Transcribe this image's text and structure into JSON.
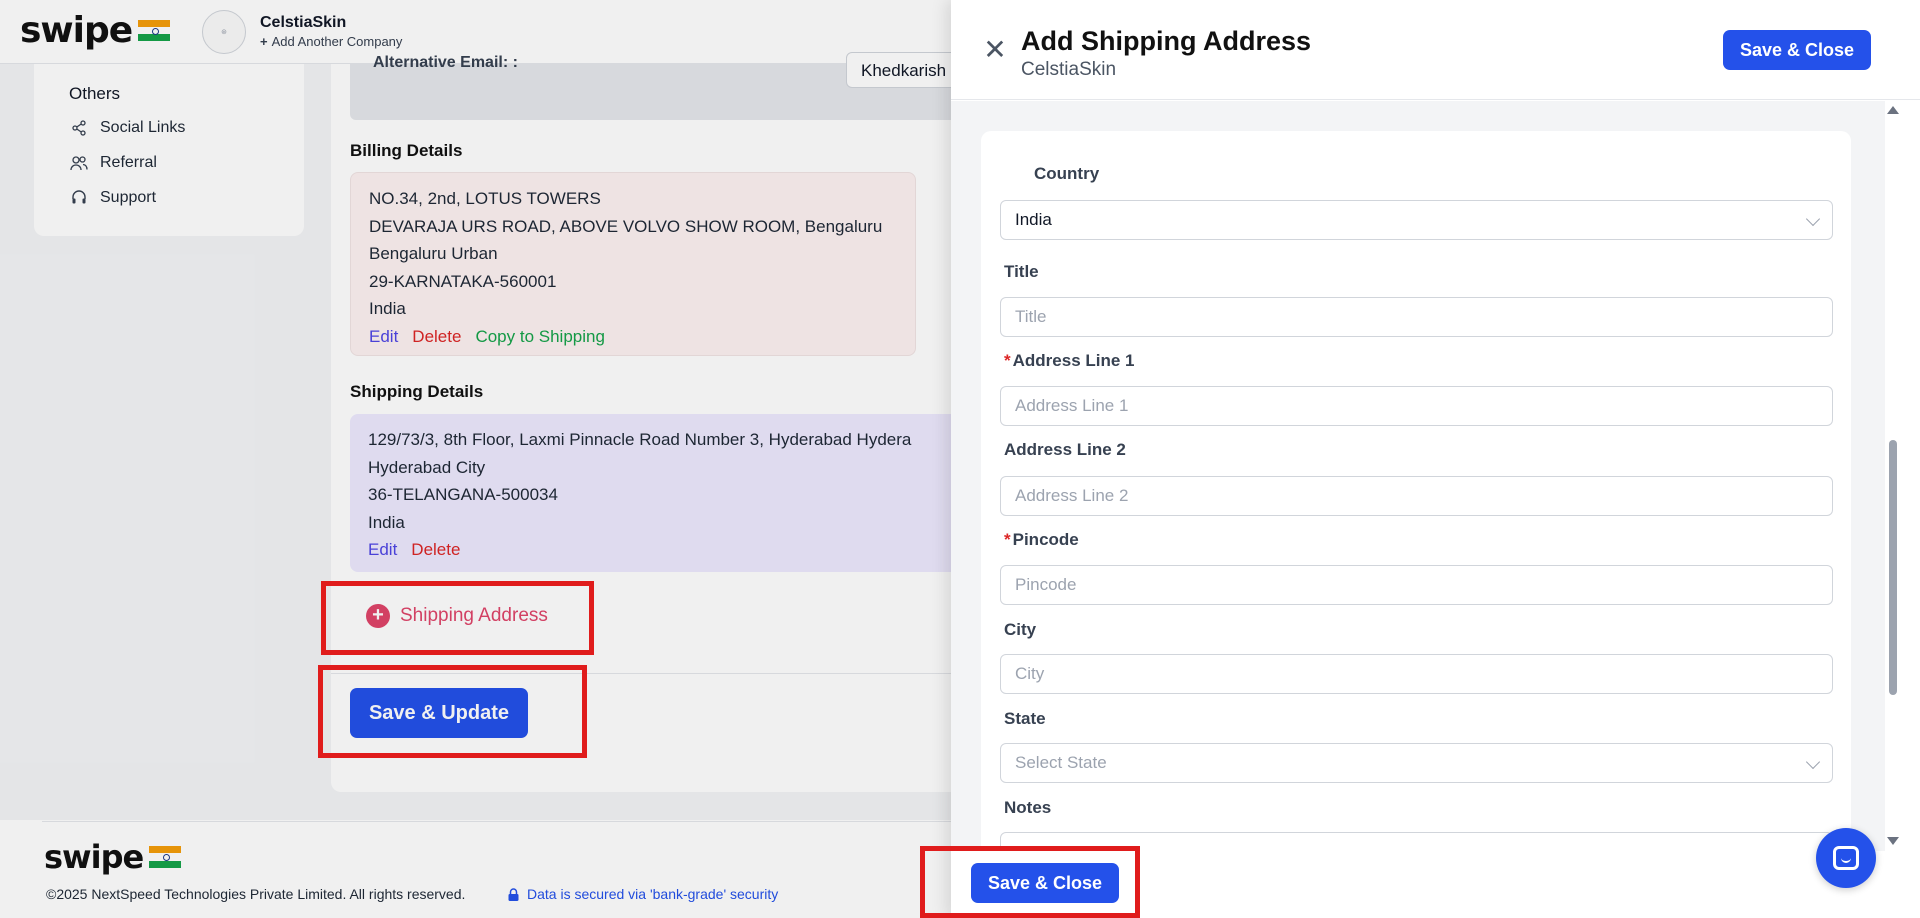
{
  "header": {
    "brand": "swipe",
    "company_name": "CelstiaSkin",
    "add_company": "Add Another Company"
  },
  "sidebar": {
    "heading": "Others",
    "items": [
      {
        "label": "Social Links",
        "icon": "share-icon"
      },
      {
        "label": "Referral",
        "icon": "users-icon"
      },
      {
        "label": "Support",
        "icon": "headset-icon"
      }
    ]
  },
  "main": {
    "alt_email_label": "Alternative Email: :",
    "alt_email_value": "Khedkarish",
    "billing": {
      "title": "Billing Details",
      "lines": [
        "NO.34, 2nd, LOTUS TOWERS",
        "DEVARAJA URS ROAD, ABOVE VOLVO SHOW ROOM, Bengaluru",
        "Bengaluru Urban",
        "29-KARNATAKA-560001",
        "India"
      ],
      "edit": "Edit",
      "delete": "Delete",
      "copy": "Copy to Shipping"
    },
    "shipping": {
      "title": "Shipping Details",
      "lines": [
        "129/73/3, 8th Floor, Laxmi Pinnacle Road Number 3, Hyderabad Hydera",
        "Hyderabad City",
        "36-TELANGANA-500034",
        "India"
      ],
      "edit": "Edit",
      "delete": "Delete"
    },
    "add_shipping_label": "Shipping Address",
    "save_update_label": "Save & Update"
  },
  "footer": {
    "brand": "swipe",
    "copyright": "©2025 NextSpeed Technologies Private Limited. All rights reserved.",
    "secure_text": "Data is secured via 'bank-grade' security"
  },
  "drawer": {
    "title": "Add Shipping Address",
    "subtitle": "CelstiaSkin",
    "save_close_label": "Save & Close",
    "fields": {
      "country": {
        "label": "Country",
        "value": "India"
      },
      "title": {
        "label": "Title",
        "placeholder": "Title"
      },
      "address1": {
        "label": "Address Line 1",
        "placeholder": "Address Line 1",
        "required": "*"
      },
      "address2": {
        "label": "Address Line 2",
        "placeholder": "Address Line 2"
      },
      "pincode": {
        "label": "Pincode",
        "placeholder": "Pincode",
        "required": "*"
      },
      "city": {
        "label": "City",
        "placeholder": "City"
      },
      "state": {
        "label": "State",
        "placeholder": "Select State"
      },
      "notes": {
        "label": "Notes"
      }
    }
  },
  "colors": {
    "primary": "#2451ea",
    "highlight": "#e01c1c",
    "delete": "#dc2626",
    "edit": "#4f46e5",
    "copy": "#16a34a",
    "add_shipping": "#e0456a"
  }
}
